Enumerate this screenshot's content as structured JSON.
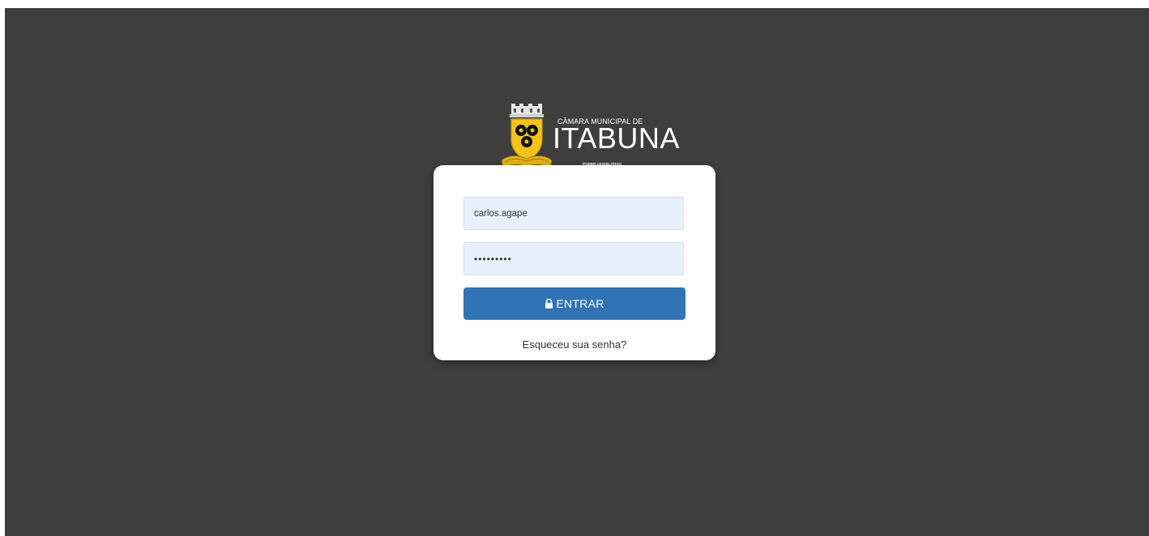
{
  "brand": {
    "line1": "CÂMARA MUNICIPAL DE",
    "name": "ITABUNA",
    "subtitle": "PODER LEGISLATIVO",
    "emblem": "coat-of-arms-icon",
    "emblem_colors": {
      "shield": "#f4c41a",
      "rings": "#000000",
      "ribbon": "#e2b21a"
    }
  },
  "login": {
    "username_value": "carlos.agape",
    "password_value": "•••••••••",
    "submit_label": "ENTRAR",
    "submit_icon": "lock-icon",
    "forgot_link": "Esqueceu sua senha?"
  },
  "colors": {
    "background": "#3e3e3e",
    "card": "#ffffff",
    "input_fill": "#e8f0fe",
    "button": "#3074b5"
  }
}
